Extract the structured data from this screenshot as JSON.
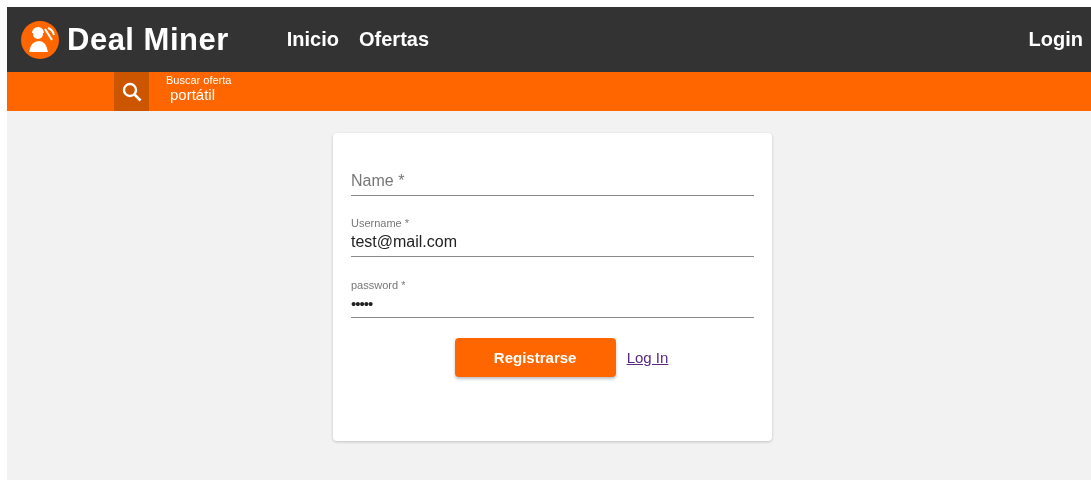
{
  "header": {
    "brand": "Deal Miner",
    "nav": [
      {
        "label": "Inicio"
      },
      {
        "label": "Ofertas"
      }
    ],
    "login": "Login"
  },
  "search": {
    "label": "Buscar oferta",
    "value": "portátil"
  },
  "form": {
    "fields": [
      {
        "placeholder": "Name *",
        "kind": "text"
      },
      {
        "label": "Username *",
        "value": "test@mail.com",
        "kind": "text"
      },
      {
        "label": "password *",
        "value": "•••••",
        "kind": "password"
      }
    ],
    "submit": "Registrarse",
    "link": "Log In"
  }
}
